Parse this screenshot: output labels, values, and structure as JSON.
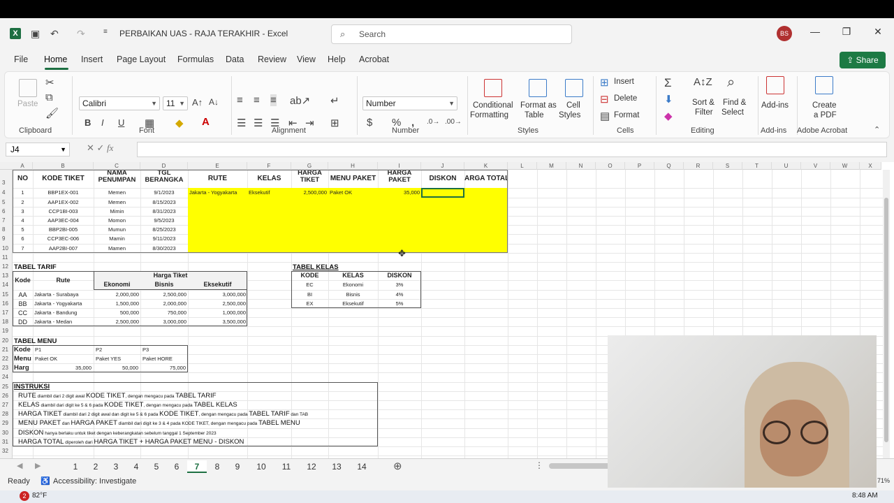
{
  "window": {
    "title": "PERBAIKAN UAS - RAJA TERAKHIR  -  Excel",
    "search_placeholder": "Search",
    "user_initials": "BS"
  },
  "menu": [
    "File",
    "Home",
    "Insert",
    "Page Layout",
    "Formulas",
    "Data",
    "Review",
    "View",
    "Help",
    "Acrobat"
  ],
  "share_label": "Share",
  "ribbon": {
    "clipboard": {
      "label": "Clipboard",
      "paste": "Paste"
    },
    "font": {
      "label": "Font",
      "name": "Calibri",
      "size": "11"
    },
    "alignment": {
      "label": "Alignment"
    },
    "number": {
      "label": "Number",
      "format": "Number"
    },
    "styles": {
      "label": "Styles",
      "conditional": "Conditional",
      "formatting": "Formatting",
      "format_as": "Format as",
      "table": "Table",
      "cell": "Cell",
      "styles_btn": "Styles"
    },
    "cells": {
      "label": "Cells",
      "insert": "Insert",
      "delete": "Delete",
      "format": "Format"
    },
    "editing": {
      "label": "Editing",
      "sort": "Sort &",
      "filter": "Filter",
      "find": "Find &",
      "select": "Select"
    },
    "addins": {
      "label": "Add-ins",
      "btn": "Add-ins"
    },
    "acrobat": {
      "label": "Adobe Acrobat",
      "create": "Create",
      "pdf": "a PDF"
    }
  },
  "formula_bar": {
    "name_box": "J4",
    "fx": "fx",
    "value": ""
  },
  "columns": [
    "A",
    "B",
    "C",
    "D",
    "E",
    "F",
    "G",
    "H",
    "I",
    "J",
    "K",
    "L",
    "M",
    "N",
    "O",
    "P",
    "Q",
    "R",
    "S",
    "T",
    "U",
    "V",
    "W",
    "X"
  ],
  "rows": [
    "3",
    "4",
    "5",
    "6",
    "7",
    "8",
    "9",
    "10",
    "11",
    "12",
    "13",
    "14",
    "15",
    "16",
    "17",
    "18",
    "19",
    "20",
    "21",
    "22",
    "23",
    "24",
    "25",
    "26",
    "27",
    "28",
    "29",
    "30",
    "31",
    "32"
  ],
  "main_table": {
    "headers": [
      "NO",
      "KODE TIKET",
      "NAMA PENUMPANG",
      "TGL BERANGKAT",
      "RUTE",
      "KELAS",
      "HARGA TIKET",
      "MENU PAKET",
      "HARGA PAKET MENU",
      "DISKON",
      "HARGA TOTAL"
    ],
    "header_display": [
      "NO",
      "KODE TIKET",
      "NAMA\nPENUMPAN",
      "TGL\nBERANGKA",
      "RUTE",
      "KELAS",
      "HARGA\nTIKET",
      "MENU PAKET",
      "HARGA\nPAKET",
      "DISKON",
      "ARGA TOTAL"
    ],
    "rows": [
      [
        "1",
        "BBP1EX-001",
        "Memen",
        "9/1/2023",
        "Jakarta - Yogyakarta",
        "Eksekutif",
        "2,500,000",
        "Paket OK",
        "35,000",
        "",
        ""
      ],
      [
        "2",
        "AAP1EX-002",
        "Memen",
        "8/15/2023",
        "",
        "",
        "",
        "",
        "",
        "",
        ""
      ],
      [
        "3",
        "CCP1BI-003",
        "Mimin",
        "8/31/2023",
        "",
        "",
        "",
        "",
        "",
        "",
        ""
      ],
      [
        "4",
        "AAP3EC-004",
        "Momon",
        "9/5/2023",
        "",
        "",
        "",
        "",
        "",
        "",
        ""
      ],
      [
        "5",
        "BBP2BI-005",
        "Mumun",
        "8/25/2023",
        "",
        "",
        "",
        "",
        "",
        "",
        ""
      ],
      [
        "6",
        "CCP3EC-006",
        "Mamin",
        "9/11/2023",
        "",
        "",
        "",
        "",
        "",
        "",
        ""
      ],
      [
        "7",
        "AAP2BI-007",
        "Mamen",
        "8/30/2023",
        "",
        "",
        "",
        "",
        "",
        "",
        ""
      ]
    ]
  },
  "tabel_tarif": {
    "title": "TABEL TARIF",
    "headers": [
      "Kode",
      "Rute",
      "Harga Tiket",
      "Ekonomi",
      "Bisnis",
      "Eksekutif"
    ],
    "rows": [
      [
        "AA",
        "Jakarta - Surabaya",
        "2,000,000",
        "2,500,000",
        "3,000,000"
      ],
      [
        "BB",
        "Jakarta - Yogyakarta",
        "1,500,000",
        "2,000,000",
        "2,500,000"
      ],
      [
        "CC",
        "Jakarta - Bandung",
        "500,000",
        "750,000",
        "1,000,000"
      ],
      [
        "DD",
        "Jakarta - Medan",
        "2,500,000",
        "3,000,000",
        "3,500,000"
      ]
    ]
  },
  "tabel_kelas": {
    "title": "TABEL KELAS",
    "headers": [
      "KODE",
      "KELAS",
      "DISKON"
    ],
    "rows": [
      [
        "EC",
        "Ekonomi",
        "3%"
      ],
      [
        "BI",
        "Bisnis",
        "4%"
      ],
      [
        "EX",
        "Eksekutif",
        "5%"
      ]
    ]
  },
  "tabel_menu": {
    "title": "TABEL MENU",
    "row_labels": [
      "Kode",
      "Menu",
      "Harg"
    ],
    "codes": [
      "P1",
      "P2",
      "P3"
    ],
    "menus": [
      "Paket OK",
      "Paket YES",
      "Paket HORE"
    ],
    "prices": [
      "35,000",
      "50,000",
      "75,000"
    ]
  },
  "instruksi": {
    "title": "INSTRUKSI",
    "lines": [
      {
        "a": "RUTE",
        "b": " diambil dari 2 digit awal ",
        "c": "KODE TIKET",
        "d": ", dengan mengacu pada ",
        "e": "TABEL TARIF",
        "f": ""
      },
      {
        "a": "KELAS",
        "b": " diambil dari digit ke 5 & 6 pada ",
        "c": "KODE TIKET",
        "d": ", dengan mengacu pada ",
        "e": "TABEL KELAS",
        "f": ""
      },
      {
        "a": "HARGA TIKET",
        "b": " diambil dari 2 digit awal dan digit ke 5 & 6 pada ",
        "c": "KODE TIKET",
        "d": ", dengan mengacu pada ",
        "e": "TABEL TARIF",
        "f": " dan TAB"
      },
      {
        "a": "MENU PAKET",
        "b": " dan ",
        "c": "HARGA PAKET",
        "d": " diambil dari digit ke 3 & 4 pada KODE TIKET, dengan mengacu pada ",
        "e": "TABEL MENU",
        "f": ""
      },
      {
        "a": "DISKON",
        "b": " hanya berlaku untuk tiket dengan keberangkatan sebelum tanggal 1 September 2023",
        "c": "",
        "d": "",
        "e": "",
        "f": ""
      },
      {
        "a": "HARGA TOTAL",
        "b": " diperoleh dari ",
        "c": "HARGA TIKET + HARGA PAKET MENU - DISKON",
        "d": "",
        "e": "",
        "f": ""
      }
    ]
  },
  "sheet_tabs": [
    "1",
    "2",
    "3",
    "4",
    "5",
    "6",
    "7",
    "8",
    "9",
    "10",
    "11",
    "12",
    "13",
    "14"
  ],
  "active_sheet": "7",
  "status": {
    "ready": "Ready",
    "accessibility": "Accessibility: Investigate",
    "zoom": "71%"
  },
  "taskbar": {
    "weather": "82°F",
    "time": "8:48 AM"
  },
  "colors": {
    "excel_green": "#1d6f42",
    "highlight_yellow": "#ffff00",
    "share_green": "#1d7a44"
  }
}
